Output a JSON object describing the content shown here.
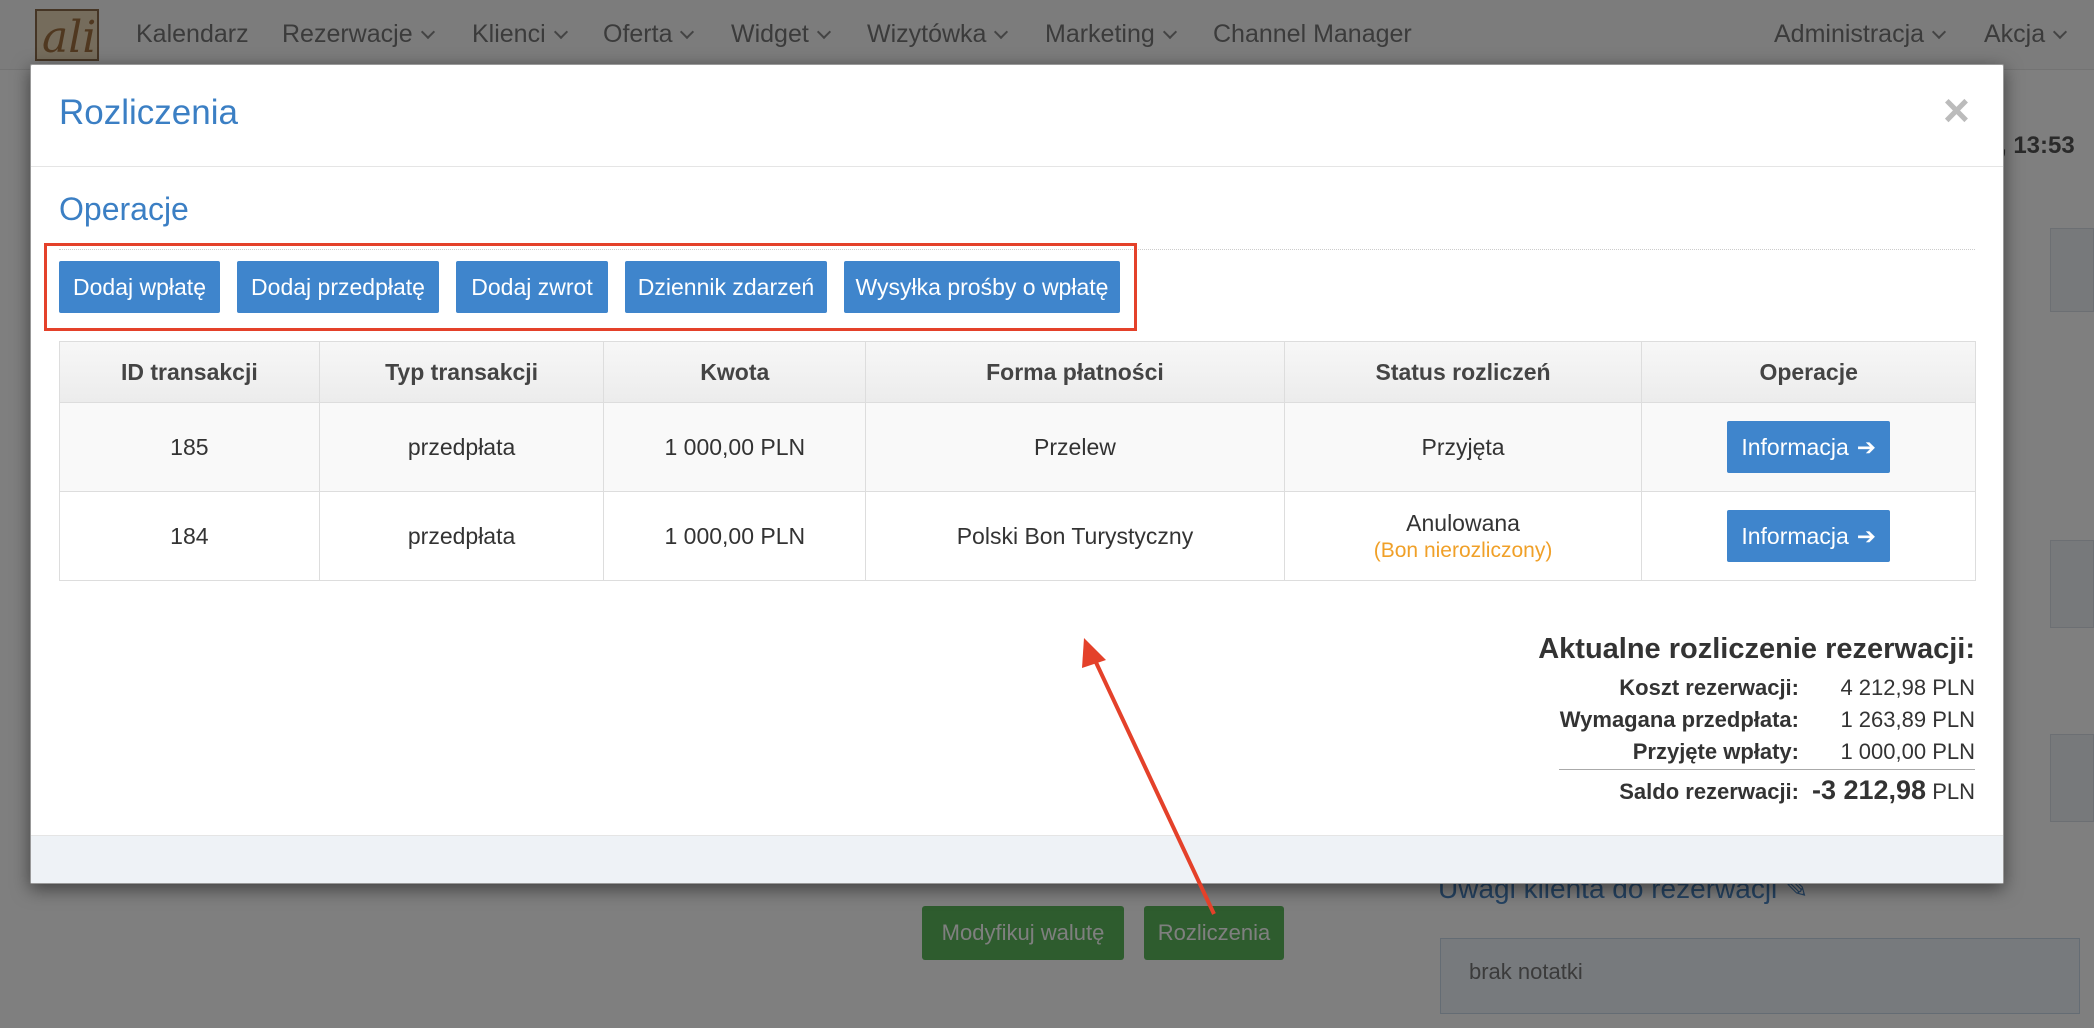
{
  "navbar": {
    "items": [
      {
        "label": "Kalendarz",
        "dropdown": false
      },
      {
        "label": "Rezerwacje",
        "dropdown": true
      },
      {
        "label": "Klienci",
        "dropdown": true
      },
      {
        "label": "Oferta",
        "dropdown": true
      },
      {
        "label": "Widget",
        "dropdown": true
      },
      {
        "label": "Wizytówka",
        "dropdown": true
      },
      {
        "label": "Marketing",
        "dropdown": true
      },
      {
        "label": "Channel Manager",
        "dropdown": false
      }
    ],
    "right_items": [
      {
        "label": "Administracja",
        "dropdown": true
      },
      {
        "label": "Akcja",
        "dropdown": true
      }
    ]
  },
  "background": {
    "time_text": ", 13:53",
    "buttons": {
      "modify_currency": "Modyfikuj walutę",
      "settlements": "Rozliczenia"
    },
    "notes_heading": "Uwagi klienta do rezerwacji",
    "notes_text": "brak notatki"
  },
  "modal": {
    "title": "Rozliczenia",
    "close_symbol": "×",
    "section_title": "Operacje",
    "buttons": {
      "add_payment": "Dodaj wpłatę",
      "add_prepayment": "Dodaj przedpłatę",
      "add_refund": "Dodaj zwrot",
      "event_log": "Dziennik zdarzeń",
      "send_payment_request": "Wysyłka prośby o wpłatę"
    },
    "table": {
      "headers": [
        "ID transakcji",
        "Typ transakcji",
        "Kwota",
        "Forma płatności",
        "Status rozliczeń",
        "Operacje"
      ],
      "rows": [
        {
          "id": "185",
          "type": "przedpłata",
          "amount": "1 000,00 PLN",
          "method": "Przelew",
          "status": "Przyjęta",
          "status_note": "",
          "action": "Informacja"
        },
        {
          "id": "184",
          "type": "przedpłata",
          "amount": "1 000,00 PLN",
          "method": "Polski Bon Turystyczny",
          "status": "Anulowana",
          "status_note": "(Bon nierozliczony)",
          "action": "Informacja"
        }
      ]
    },
    "summary": {
      "title": "Aktualne rozliczenie rezerwacji:",
      "cost_label": "Koszt rezerwacji:",
      "cost_value": "4 212,98 PLN",
      "required_label": "Wymagana przedpłata:",
      "required_value": "1 263,89 PLN",
      "received_label": "Przyjęte wpłaty:",
      "received_value": "1 000,00 PLN",
      "balance_label": "Saldo rezerwacji:",
      "balance_amount": "-3 212,98",
      "balance_currency": "PLN"
    }
  },
  "colors": {
    "primary": "#3f85cc",
    "title": "#3b7fc4",
    "annotation": "#e4412a",
    "warning": "#f0a028",
    "success": "#5cb85c"
  }
}
